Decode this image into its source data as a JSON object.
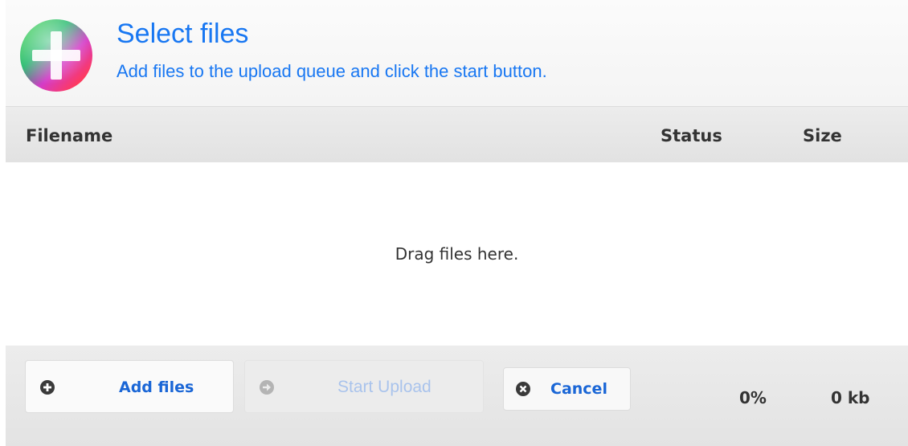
{
  "header": {
    "title": "Select files",
    "subtitle": "Add files to the upload queue and click the start button.",
    "logo_icon": "plus-circle-icon"
  },
  "columns": {
    "filename": "Filename",
    "status": "Status",
    "size": "Size"
  },
  "drop_area": {
    "text": "Drag files here."
  },
  "footer": {
    "add_files_label": "Add files",
    "start_upload_label": "Start Upload",
    "cancel_label": "Cancel",
    "total_percent": "0%",
    "total_size": "0 kb",
    "icons": {
      "add": "plus-icon",
      "start": "arrow-right-icon",
      "cancel": "close-icon"
    }
  },
  "colors": {
    "accent": "#1877f2",
    "button_text": "#1a66d6",
    "disabled_text": "#a9c3ec",
    "text": "#333333"
  }
}
